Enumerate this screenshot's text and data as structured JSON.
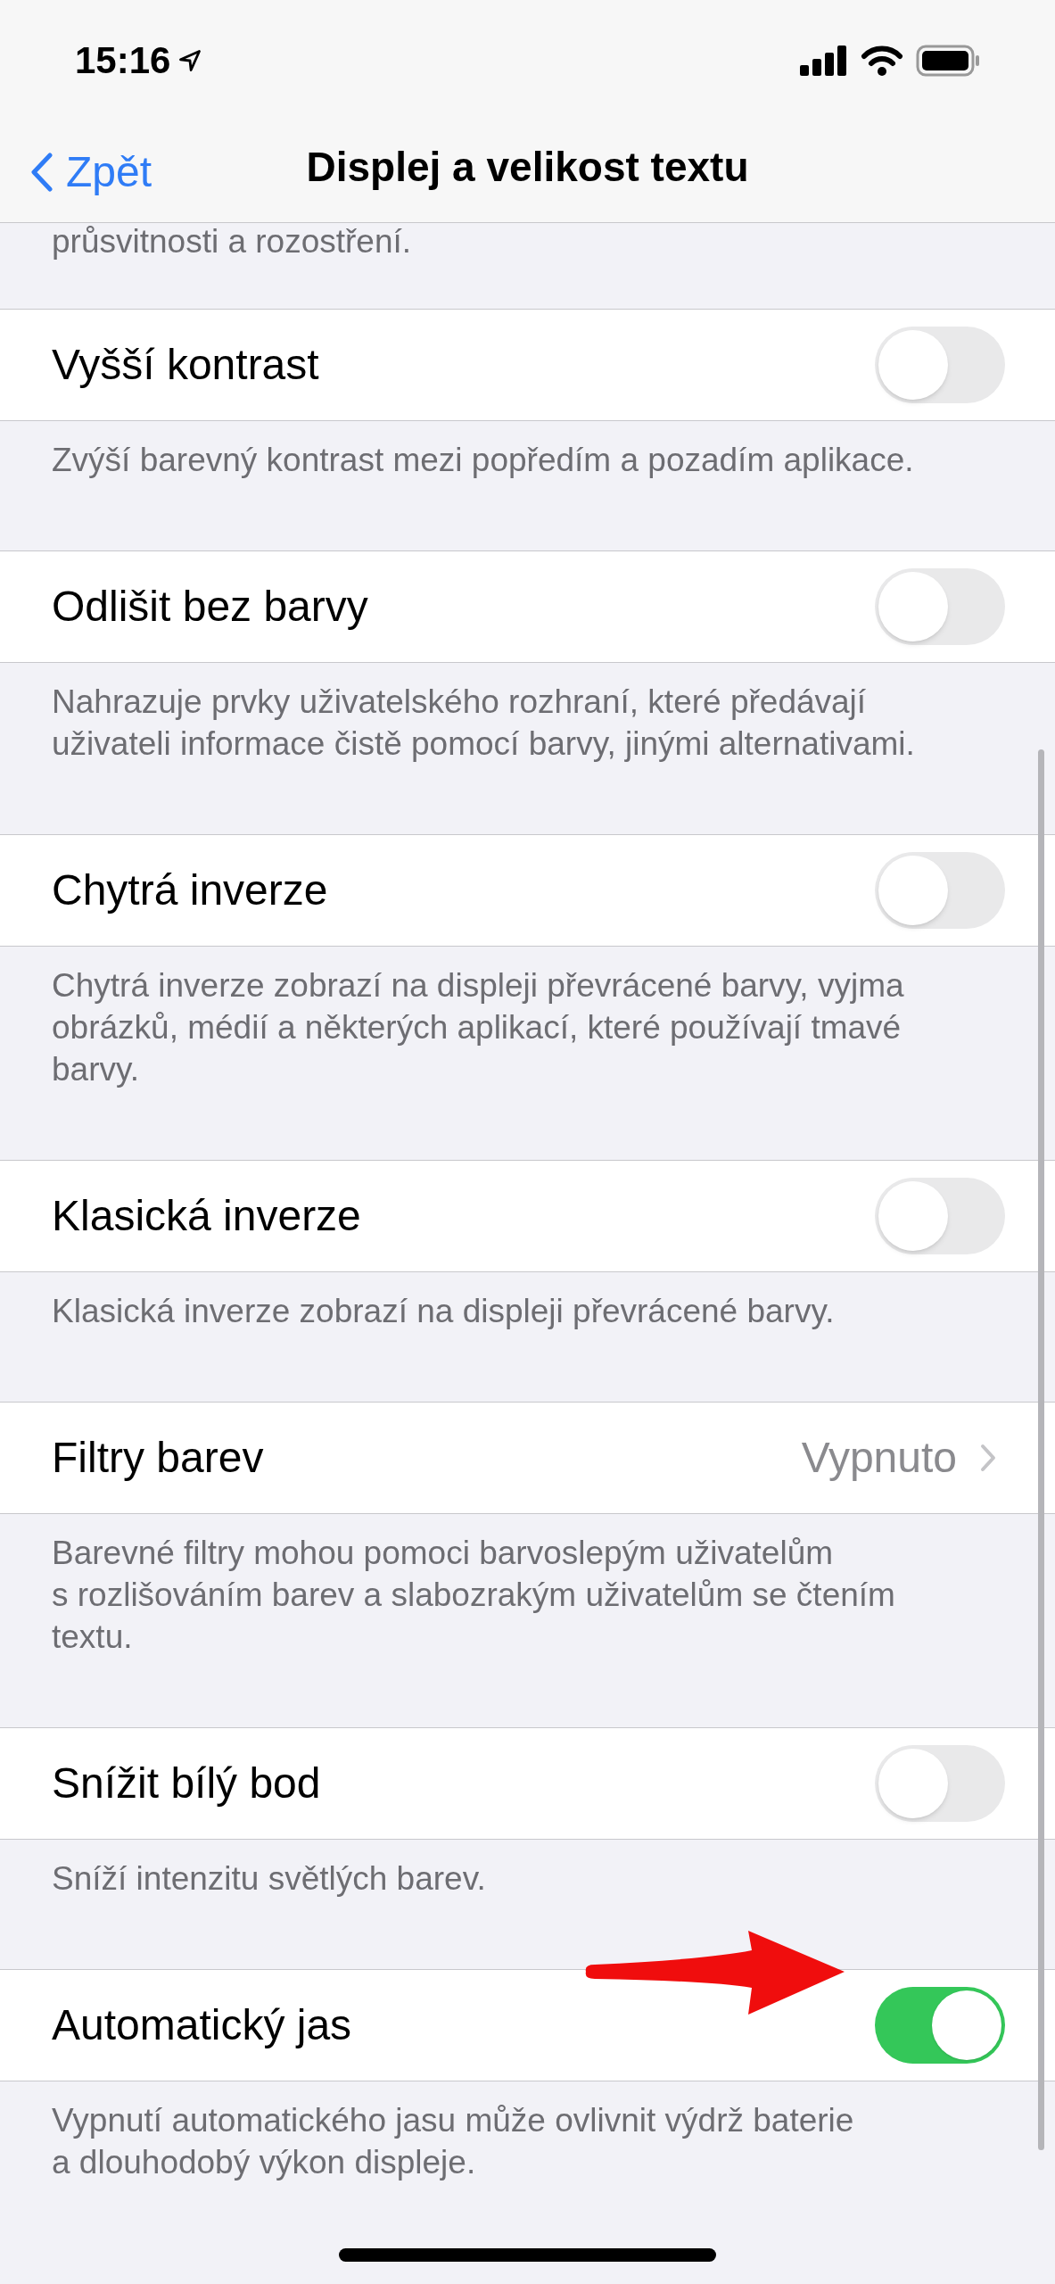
{
  "status_bar": {
    "time": "15:16"
  },
  "nav": {
    "back": "Zpět",
    "title": "Displej a velikost textu"
  },
  "cut_text": "průsvitnosti a rozostření.",
  "sections": [
    {
      "kind": "toggle",
      "label": "Vyšší kontrast",
      "on": false,
      "footer": "Zvýší barevný kontrast mezi popředím a pozadím aplikace."
    },
    {
      "kind": "toggle",
      "label": "Odlišit bez barvy",
      "on": false,
      "footer": "Nahrazuje prvky uživatelského rozhraní, které předávají\nuživateli informace čistě pomocí barvy, jinými alternativami."
    },
    {
      "kind": "toggle",
      "label": "Chytrá inverze",
      "on": false,
      "footer": "Chytrá inverze zobrazí na displeji převrácené barvy, vyjma\nobrázků, médií a některých aplikací, které používají tmavé\nbarvy."
    },
    {
      "kind": "toggle",
      "label": "Klasická inverze",
      "on": false,
      "footer": "Klasická inverze zobrazí na displeji převrácené barvy."
    },
    {
      "kind": "link",
      "label": "Filtry barev",
      "value": "Vypnuto",
      "footer": "Barevné filtry mohou pomoci barvoslepým uživatelům\ns rozlišováním barev a slabozrakým uživatelům se čtením\ntextu."
    },
    {
      "kind": "toggle",
      "label": "Snížit bílý bod",
      "on": false,
      "footer": "Sníží intenzitu světlých barev."
    },
    {
      "kind": "toggle",
      "label": "Automatický jas",
      "on": true,
      "footer": "Vypnutí automatického jasu může ovlivnit výdrž baterie\na dlouhodobý výkon displeje."
    }
  ]
}
